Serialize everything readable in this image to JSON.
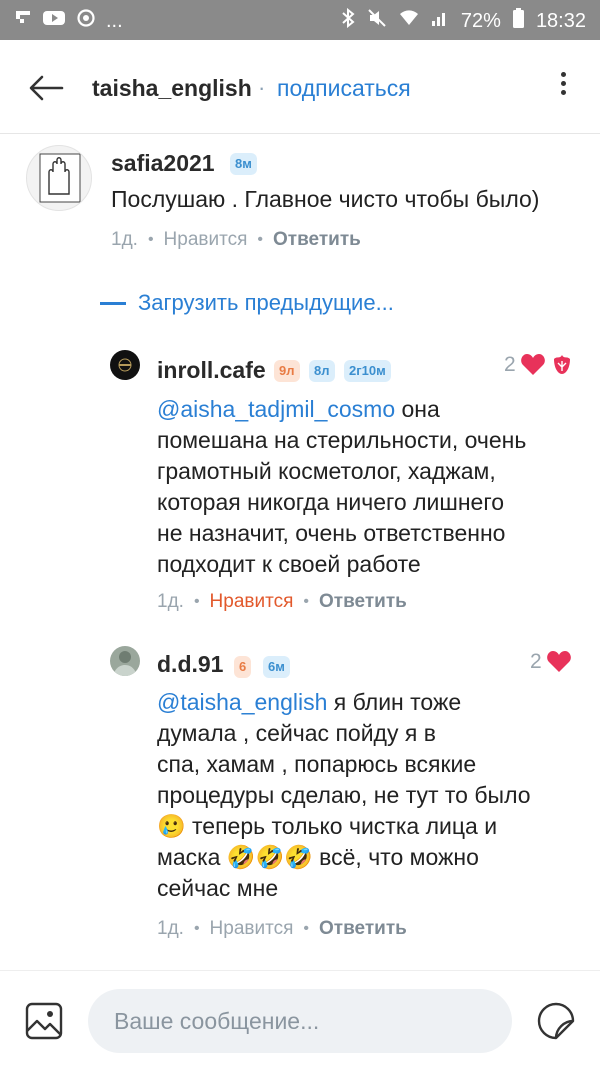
{
  "status_bar": {
    "battery": "72%",
    "time": "18:32",
    "notification_more": "..."
  },
  "header": {
    "username": "taisha_english",
    "separator": "·",
    "subscribe": "подписаться"
  },
  "comments": [
    {
      "user": "safia2021",
      "badges": [
        "8м"
      ],
      "text": "Послушаю . Главное чисто чтобы было)",
      "time": "1д.",
      "like": "Нравится",
      "reply": "Ответить"
    }
  ],
  "load_previous": "Загрузить предыдущие...",
  "replies": [
    {
      "user": "inroll.cafe",
      "badges": [
        "9л",
        "8л",
        "2г10м"
      ],
      "likes": "2",
      "mention": "@aisha_tadjmil_cosmo",
      "lines": [
        " она",
        "помешана на стерильности, очень",
        "грамотный косметолог, хаджам,",
        "которая никогда ничего лишнего",
        "не назначит,  очень ответственно",
        "подходит к своей работе"
      ],
      "time": "1д.",
      "like": "Нравится",
      "reply": "Ответить"
    },
    {
      "user": "d.d.91",
      "badges": [
        "6",
        "6м"
      ],
      "likes": "2",
      "mention": "@taisha_english",
      "lines": [
        " я блин тоже",
        "думала , сейчас пойду я в",
        "спа, хамам , попарюсь всякие",
        "процедуры сделаю,  не тут то было",
        "🥲 теперь только чистка лица и",
        "маска 🤣🤣🤣 всё,  что можно",
        "сейчас мне"
      ],
      "time": "1д.",
      "like": "Нравится",
      "reply": "Ответить"
    }
  ],
  "composer": {
    "placeholder": "Ваше сообщение..."
  },
  "colors": {
    "accent": "#2a7fd4",
    "like_active": "#e2592c",
    "heart": "#e8325a",
    "status_bar": "#8a8a8a"
  }
}
